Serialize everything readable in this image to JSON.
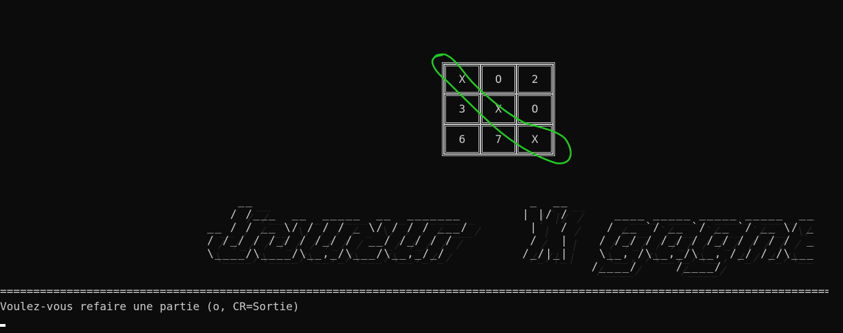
{
  "board": {
    "cells": [
      "X",
      "O",
      "2",
      "3",
      "X",
      "O",
      "6",
      "7",
      "X"
    ]
  },
  "highlight": {
    "color": "#22cc22"
  },
  "banner": {
    "ascii": "    __                                    _  __                                    _____\n   / /___  __  _____  __  _______        | |/ /      ____ _____ _____ _____  ___  / / / /\n__ / / __ \\/ / / / _ \\/ / / / ___/        |   /     / __ `/ __ `/ __ `/ __ \\/ _ \\/ / / /\n/ /_/ / /_/ / /_/ /  __/ /_/ / /          /   |    / /_/ / /_/ / /_/ / / / /  __/_/_/_/\n\\____/\\____/\\__,_/\\___/\\__,_/_/          /_/|_|    \\__, /\\__,_/\\__, /_/ /_/\\___(_|_|_)\n                                                  /____/     /____/"
  },
  "separator": "========================================================================================================================================================",
  "prompt": "Voulez-vous refaire une partie (o, CR=Sortie)"
}
